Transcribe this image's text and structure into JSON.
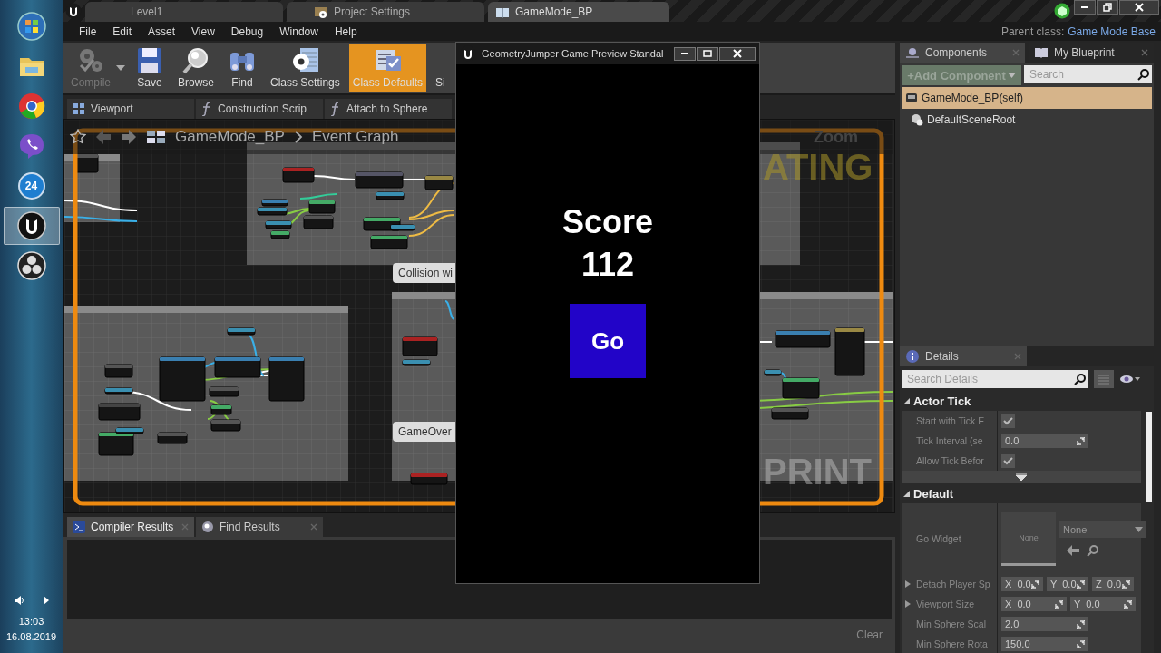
{
  "taskbar": {
    "apps": [
      {
        "kind": "start",
        "selected": false
      },
      {
        "kind": "folder",
        "selected": false
      },
      {
        "kind": "chrome",
        "selected": false
      },
      {
        "kind": "viber",
        "selected": false
      },
      {
        "kind": "badge",
        "label": "24",
        "selected": false
      },
      {
        "kind": "unreal",
        "selected": true
      },
      {
        "kind": "obs",
        "selected": false
      }
    ],
    "clock": {
      "time": "13:03",
      "date": "16.08.2019"
    }
  },
  "editor": {
    "tabs": [
      {
        "label": "Level1",
        "kind": "level",
        "selected": false
      },
      {
        "label": "Project Settings",
        "kind": "settings",
        "selected": false
      },
      {
        "label": "GameMode_BP",
        "kind": "blueprint",
        "selected": true
      }
    ],
    "menu": [
      "File",
      "Edit",
      "Asset",
      "View",
      "Debug",
      "Window",
      "Help"
    ],
    "parent_class": {
      "label": "Parent class:",
      "value": "Game Mode Base"
    },
    "toolbar": [
      {
        "label": "Compile",
        "kind": "compile",
        "disabled": true,
        "selected": false
      },
      {
        "label": "Save",
        "kind": "save",
        "disabled": false,
        "selected": false
      },
      {
        "label": "Browse",
        "kind": "browse",
        "disabled": false,
        "selected": false
      },
      {
        "label": "Find",
        "kind": "find",
        "disabled": false,
        "selected": false
      },
      {
        "label": "Class Settings",
        "kind": "settings",
        "disabled": false,
        "selected": false
      },
      {
        "label": "Class Defaults",
        "kind": "defaults",
        "disabled": false,
        "selected": true
      },
      {
        "label": "Si",
        "kind": "text",
        "disabled": false,
        "selected": false
      }
    ],
    "doc_tabs": [
      {
        "label": "Viewport",
        "kind": "viewport",
        "selected": false
      },
      {
        "label": "Construction Scrip",
        "kind": "function",
        "selected": false
      },
      {
        "label": "Attach to Sphere",
        "kind": "function",
        "selected": false
      }
    ],
    "breadcrumb": [
      "GameMode_BP",
      "Event Graph"
    ],
    "graph": {
      "zoom": "Zoom",
      "watermark_top": "ATING",
      "watermark_bottom": "PRINT",
      "comments": [
        {
          "label": "Collision wi"
        },
        {
          "label": "GameOver"
        }
      ]
    },
    "bottom_tabs": [
      {
        "label": "Compiler Results",
        "kind": "compiler",
        "selected": true
      },
      {
        "label": "Find Results",
        "kind": "find",
        "selected": false
      }
    ],
    "clear_button": "Clear"
  },
  "components": {
    "tabs": [
      {
        "label": "Components",
        "kind": "components",
        "selected": true
      },
      {
        "label": "My Blueprint",
        "kind": "book",
        "selected": false
      }
    ],
    "add_button": "+Add Component",
    "search": {
      "placeholder": "Search"
    },
    "tree": [
      {
        "label": "GameMode_BP(self)",
        "selected": true,
        "children": [
          {
            "label": "DefaultSceneRoot",
            "selected": false
          }
        ]
      }
    ]
  },
  "details": {
    "tab": "Details",
    "search": {
      "placeholder": "Search Details"
    },
    "sections": [
      {
        "title": "Actor Tick",
        "props": [
          {
            "kind": "checkbox",
            "label": "Start with Tick E",
            "checked": true
          },
          {
            "kind": "number",
            "label": "Tick Interval (se",
            "value": "0.0"
          },
          {
            "kind": "checkbox",
            "label": "Allow Tick Befor",
            "checked": true
          }
        ]
      },
      {
        "title": "Default",
        "props": [
          {
            "kind": "asset",
            "label": "Go Widget",
            "thumbnail": "None",
            "value": "None"
          },
          {
            "kind": "vector",
            "label": "Detach Player Sp",
            "fields": [
              {
                "axis": "X",
                "value": "0.0"
              },
              {
                "axis": "Y",
                "value": "0.0"
              },
              {
                "axis": "Z",
                "value": "0.0"
              }
            ]
          },
          {
            "kind": "vector",
            "label": "Viewport Size",
            "fields": [
              {
                "axis": "X",
                "value": "0.0"
              },
              {
                "axis": "Y",
                "value": "0.0"
              }
            ]
          },
          {
            "kind": "number",
            "label": "Min Sphere Scal",
            "value": "2.0"
          },
          {
            "kind": "number",
            "label": "Min Sphere Rota",
            "value": "150.0"
          }
        ]
      }
    ]
  },
  "preview": {
    "title": "GeometryJumper Game Preview Standal",
    "score_label": "Score",
    "score": "112",
    "button": "Go"
  }
}
